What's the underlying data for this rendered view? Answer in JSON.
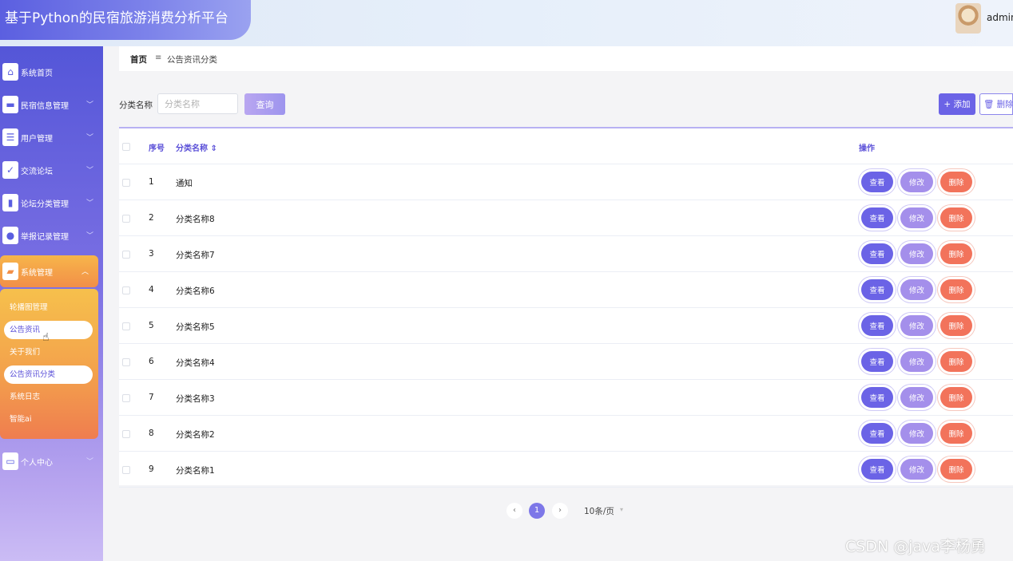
{
  "header": {
    "title": "基于Python的民宿旅游消费分析平台",
    "username": "admin"
  },
  "sidebar": {
    "items": [
      {
        "label": "系统首页",
        "icon": "home-icon"
      },
      {
        "label": "民宿信息管理",
        "icon": "monitor-icon"
      },
      {
        "label": "用户管理",
        "icon": "sliders-icon"
      },
      {
        "label": "交流论坛",
        "icon": "clipboard-check-icon"
      },
      {
        "label": "论坛分类管理",
        "icon": "book-icon"
      },
      {
        "label": "举报记录管理",
        "icon": "balloon-icon"
      },
      {
        "label": "系统管理",
        "icon": "briefcase-icon"
      },
      {
        "label": "个人中心",
        "icon": "card-icon"
      }
    ],
    "submenu": [
      "轮播图管理",
      "公告资讯",
      "关于我们",
      "公告资讯分类",
      "系统日志",
      "智能ai"
    ]
  },
  "breadcrumb": {
    "home": "首页",
    "separator": "≡",
    "current": "公告资讯分类"
  },
  "search": {
    "label": "分类名称",
    "placeholder": "分类名称",
    "query_label": "查询"
  },
  "toolbar": {
    "add_label": "+ 添加",
    "delete_label": "🗑 删除"
  },
  "table": {
    "headers": {
      "index": "序号",
      "name": "分类名称 ⇕",
      "actions": "操作"
    },
    "rows": [
      {
        "index": "1",
        "name": "通知"
      },
      {
        "index": "2",
        "name": "分类名称8"
      },
      {
        "index": "3",
        "name": "分类名称7"
      },
      {
        "index": "4",
        "name": "分类名称6"
      },
      {
        "index": "5",
        "name": "分类名称5"
      },
      {
        "index": "6",
        "name": "分类名称4"
      },
      {
        "index": "7",
        "name": "分类名称3"
      },
      {
        "index": "8",
        "name": "分类名称2"
      },
      {
        "index": "9",
        "name": "分类名称1"
      }
    ],
    "actions": {
      "view": "查看",
      "edit": "修改",
      "delete": "删除"
    }
  },
  "pagination": {
    "prev": "‹",
    "page": "1",
    "next": "›",
    "page_size": "10条/页"
  },
  "watermark": "CSDN @java李杨勇",
  "colors": {
    "primary": "#6b63e6",
    "accent_orange": "#f28f48",
    "danger": "#f2735b"
  }
}
